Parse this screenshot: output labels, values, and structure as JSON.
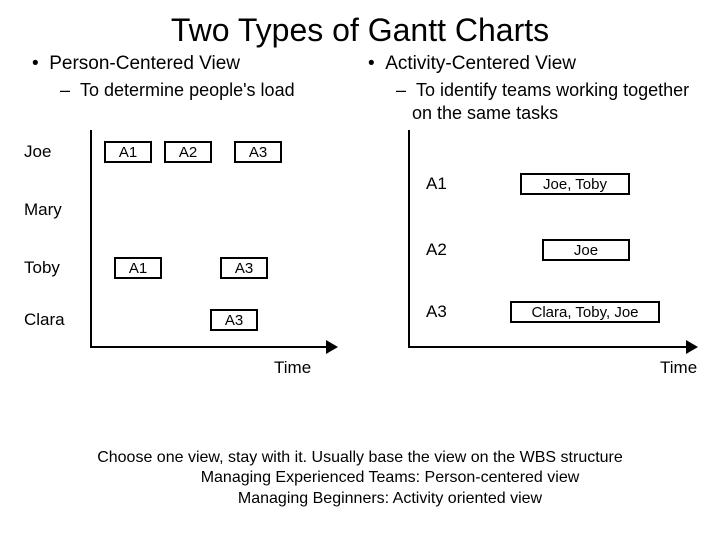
{
  "title": "Two Types of Gantt Charts",
  "left": {
    "heading": "Person-Centered View",
    "sub": "To determine people's load"
  },
  "right": {
    "heading": "Activity-Centered View",
    "sub": "To identify teams working together on the same tasks"
  },
  "time_label": "Time",
  "people": {
    "p1": "Joe",
    "p2": "Mary",
    "p3": "Toby",
    "p4": "Clara"
  },
  "acts": {
    "a1": "A1",
    "a2": "A2",
    "a3": "A3"
  },
  "team1": "Joe, Toby",
  "team2": "Joe",
  "team3": "Clara, Toby, Joe",
  "footer": {
    "l1": "Choose one view, stay with it. Usually base the  view on the WBS structure",
    "l2": "Managing Experienced Teams:  Person-centered view",
    "l3": "Managing  Beginners: Activity oriented view"
  },
  "chart_data": {
    "type": "gantt-pair",
    "left_chart": {
      "orientation": "person-centered",
      "x_axis": "Time",
      "rows": [
        {
          "person": "Joe",
          "bars": [
            "A1",
            "A2",
            "A3"
          ]
        },
        {
          "person": "Mary",
          "bars": []
        },
        {
          "person": "Toby",
          "bars": [
            "A1",
            "A3"
          ]
        },
        {
          "person": "Clara",
          "bars": [
            "A3"
          ]
        }
      ]
    },
    "right_chart": {
      "orientation": "activity-centered",
      "x_axis": "Time",
      "rows": [
        {
          "activity": "A1",
          "team": "Joe, Toby"
        },
        {
          "activity": "A2",
          "team": "Joe"
        },
        {
          "activity": "A3",
          "team": "Clara, Toby, Joe"
        }
      ]
    }
  }
}
